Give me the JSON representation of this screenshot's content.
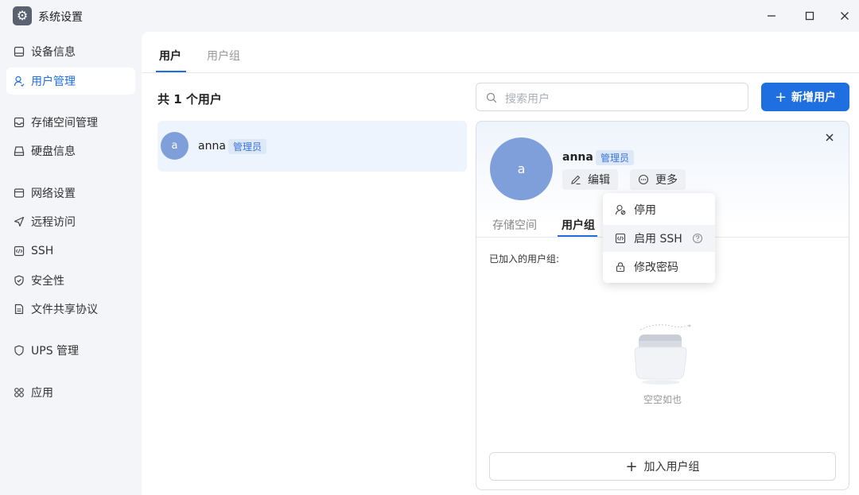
{
  "window": {
    "title": "系统设置"
  },
  "sidebar": {
    "items": [
      {
        "label": "设备信息"
      },
      {
        "label": "用户管理"
      },
      {
        "label": "存储空间管理"
      },
      {
        "label": "硬盘信息"
      },
      {
        "label": "网络设置"
      },
      {
        "label": "远程访问"
      },
      {
        "label": "SSH"
      },
      {
        "label": "安全性"
      },
      {
        "label": "文件共享协议"
      },
      {
        "label": "UPS 管理"
      },
      {
        "label": "应用"
      }
    ]
  },
  "tabs": [
    {
      "label": "用户"
    },
    {
      "label": "用户组"
    }
  ],
  "user_list": {
    "count_label": "共 1 个用户",
    "users": [
      {
        "avatar": "a",
        "name": "anna",
        "role": "管理员"
      }
    ]
  },
  "search": {
    "placeholder": "搜索用户"
  },
  "add_user_button": {
    "label": "新增用户"
  },
  "detail": {
    "avatar": "a",
    "name": "anna",
    "role": "管理员",
    "edit_label": "编辑",
    "more_label": "更多",
    "tabs": [
      {
        "label": "存储空间"
      },
      {
        "label": "用户组"
      }
    ],
    "joined_groups_label": "已加入的用户组:",
    "empty_text": "空空如也",
    "join_group_label": "加入用户组"
  },
  "more_menu": {
    "items": [
      {
        "label": "停用"
      },
      {
        "label": "启用 SSH"
      },
      {
        "label": "修改密码"
      }
    ]
  },
  "colors": {
    "accent": "#1f6fe0",
    "avatar": "#7e9fd9",
    "badge_bg": "#dde8f9"
  }
}
